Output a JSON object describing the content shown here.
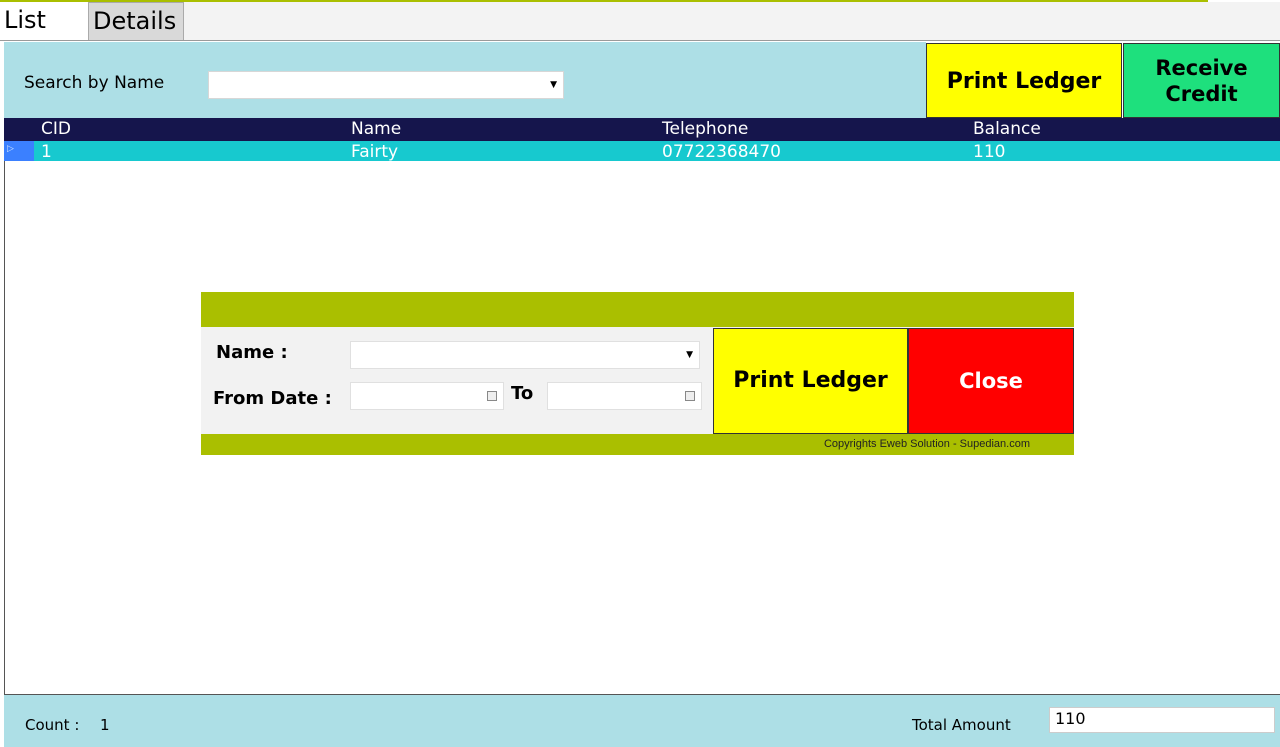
{
  "tabs": [
    {
      "label": "List",
      "active": true
    },
    {
      "label": "Details",
      "active": false
    }
  ],
  "search": {
    "label": "Search by Name",
    "value": ""
  },
  "toolbar": {
    "print_ledger_label": "Print Ledger",
    "receive_credit_label": "Receive Credit"
  },
  "grid": {
    "columns": [
      "CID",
      "Name",
      "Telephone",
      "Balance"
    ],
    "rows": [
      {
        "cid": "1",
        "name": "Fairty",
        "telephone": "07722368470",
        "balance": "110"
      }
    ]
  },
  "dialog": {
    "name_label": "Name :",
    "name_value": "",
    "from_label": "From Date :",
    "to_label": "To",
    "print_label": "Print Ledger",
    "close_label": "Close",
    "copyright": "Copyrights Eweb Solution - Supedian.com"
  },
  "footer": {
    "count_label": "Count :",
    "count_value": "1",
    "total_label": "Total Amount",
    "total_value": "110"
  },
  "colors": {
    "accent_green": "#aabf00",
    "search_bg": "#addfe6",
    "header_navy": "#15154c",
    "row_selected": "#17c9cf",
    "print_yellow": "#ffff00",
    "receive_green": "#1ee07d",
    "close_red": "#ff0000"
  }
}
